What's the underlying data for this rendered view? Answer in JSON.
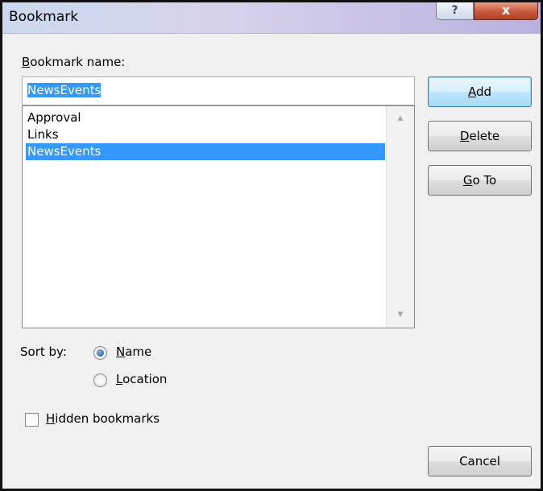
{
  "window": {
    "title": "Bookmark",
    "help_glyph": "?",
    "close_glyph": "x"
  },
  "bookmark_name": {
    "label_underlined": "B",
    "label_rest": "ookmark name:",
    "value": "NewsEvents"
  },
  "bookmarks": [
    {
      "name": "Approval",
      "selected": false
    },
    {
      "name": "Links",
      "selected": false
    },
    {
      "name": "NewsEvents",
      "selected": true
    }
  ],
  "buttons": {
    "add_underlined": "A",
    "add_rest": "dd",
    "delete_underlined": "D",
    "delete_rest": "elete",
    "goto_underlined": "G",
    "goto_rest": "o To",
    "cancel": "Cancel"
  },
  "sort": {
    "label": "Sort by:",
    "name_underlined": "N",
    "name_rest": "ame",
    "location_underlined": "L",
    "location_rest": "ocation",
    "selected": "Name"
  },
  "hidden": {
    "label_underlined": "H",
    "label_rest": "idden bookmarks",
    "checked": false
  },
  "colors": {
    "selection": "#3399ff",
    "default_button_border": "#3c7fb1",
    "close_button": "#c85a3c"
  }
}
